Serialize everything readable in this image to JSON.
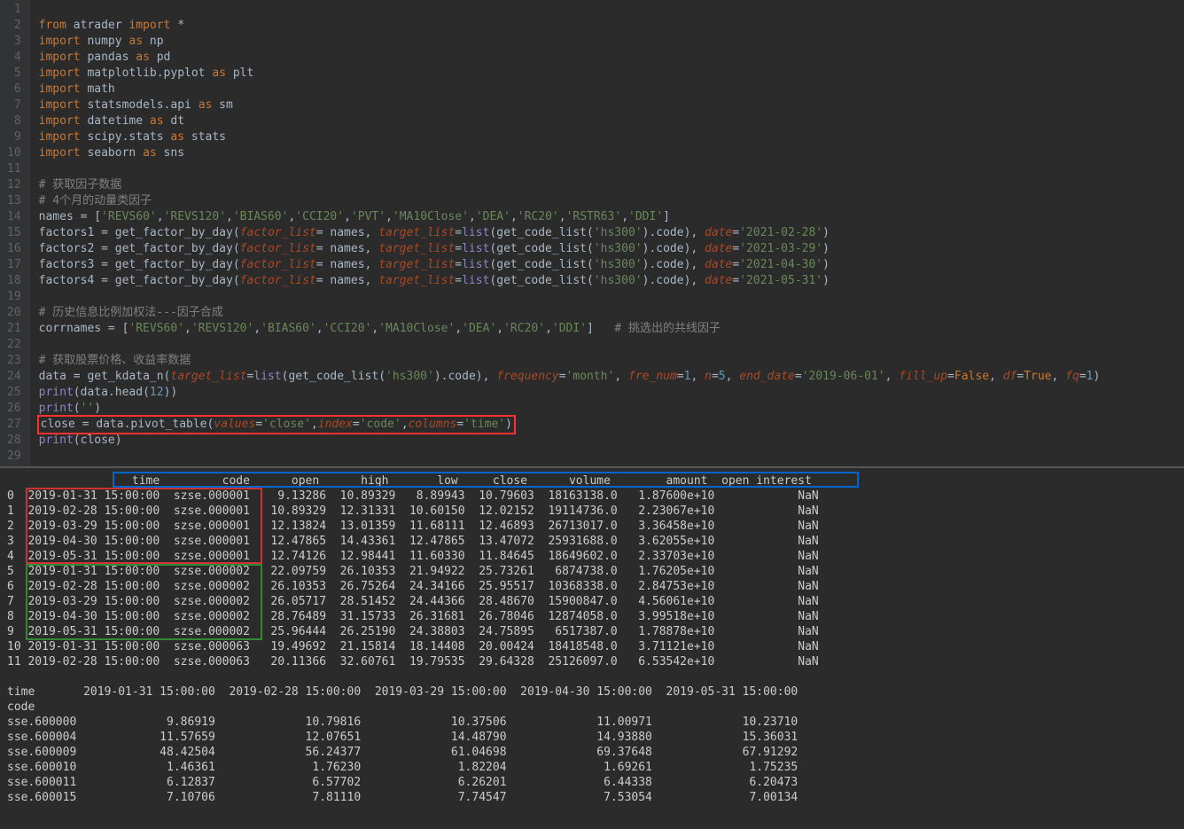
{
  "lineNumbers": [
    "1",
    "2",
    "3",
    "4",
    "5",
    "6",
    "7",
    "8",
    "9",
    "10",
    "11",
    "12",
    "13",
    "14",
    "15",
    "16",
    "17",
    "18",
    "19",
    "20",
    "21",
    "22",
    "23",
    "24",
    "25",
    "26",
    "27",
    "28",
    "29"
  ],
  "code": {
    "l2": {
      "kw1": "from",
      "mod": " atrader ",
      "kw2": "import",
      "rest": " *"
    },
    "l3": {
      "kw": "import",
      "mod": " numpy ",
      "kw2": "as",
      "alias": " np"
    },
    "l4": {
      "kw": "import",
      "mod": " pandas ",
      "kw2": "as",
      "alias": " pd"
    },
    "l5": {
      "kw": "import",
      "mod": " matplotlib.pyplot ",
      "kw2": "as",
      "alias": " plt"
    },
    "l6": {
      "kw": "import",
      "mod": " math"
    },
    "l7": {
      "kw": "import",
      "mod": " statsmodels.api ",
      "kw2": "as",
      "alias": " sm"
    },
    "l8": {
      "kw": "import",
      "mod": " datetime ",
      "kw2": "as",
      "alias": " dt"
    },
    "l9": {
      "kw": "import",
      "mod": " scipy.stats ",
      "kw2": "as",
      "alias": " stats"
    },
    "l10": {
      "kw": "import",
      "mod": " seaborn ",
      "kw2": "as",
      "alias": " sns"
    },
    "l12": {
      "com": "# 获取因子数据"
    },
    "l13": {
      "com": "# 4个月的动量类因子"
    },
    "l14": {
      "var": "names = [",
      "s1": "'REVS60'",
      "c1": ",",
      "s2": "'REVS120'",
      "c2": ",",
      "s3": "'BIAS60'",
      "c3": ",",
      "s4": "'CCI20'",
      "c4": ",",
      "s5": "'PVT'",
      "c5": ",",
      "s6": "'MA10Close'",
      "c6": ",",
      "s7": "'DEA'",
      "c7": ",",
      "s8": "'RC20'",
      "c8": ",",
      "s9": "'RSTR63'",
      "c9": ",",
      "s10": "'DDI'",
      "end": "]"
    },
    "l15": {
      "var": "factors1 = ",
      "fn": "get_factor_by_day",
      "p1": "(",
      "par1": "factor_list",
      "eq1": "= names, ",
      "par2": "target_list",
      "eq2": "=",
      "bi": "list",
      "p2": "(",
      "fn2": "get_code_list",
      "p3": "(",
      "s1": "'hs300'",
      "p4": ").code), ",
      "par3": "date",
      "eq3": "=",
      "s2": "'2021-02-28'",
      "end": ")"
    },
    "l16": {
      "var": "factors2 = ",
      "fn": "get_factor_by_day",
      "p1": "(",
      "par1": "factor_list",
      "eq1": "= names, ",
      "par2": "target_list",
      "eq2": "=",
      "bi": "list",
      "p2": "(",
      "fn2": "get_code_list",
      "p3": "(",
      "s1": "'hs300'",
      "p4": ").code), ",
      "par3": "date",
      "eq3": "=",
      "s2": "'2021-03-29'",
      "end": ")"
    },
    "l17": {
      "var": "factors3 = ",
      "fn": "get_factor_by_day",
      "p1": "(",
      "par1": "factor_list",
      "eq1": "= names, ",
      "par2": "target_list",
      "eq2": "=",
      "bi": "list",
      "p2": "(",
      "fn2": "get_code_list",
      "p3": "(",
      "s1": "'hs300'",
      "p4": ").code), ",
      "par3": "date",
      "eq3": "=",
      "s2": "'2021-04-30'",
      "end": ")"
    },
    "l18": {
      "var": "factors4 = ",
      "fn": "get_factor_by_day",
      "p1": "(",
      "par1": "factor_list",
      "eq1": "= names, ",
      "par2": "target_list",
      "eq2": "=",
      "bi": "list",
      "p2": "(",
      "fn2": "get_code_list",
      "p3": "(",
      "s1": "'hs300'",
      "p4": ").code), ",
      "par3": "date",
      "eq3": "=",
      "s2": "'2021-05-31'",
      "end": ")"
    },
    "l20": {
      "com": "# 历史信息比例加权法---因子合成"
    },
    "l21": {
      "var": "corrnames = [",
      "s1": "'REVS60'",
      "c1": ",",
      "s2": "'REVS120'",
      "c2": ",",
      "s3": "'BIAS60'",
      "c3": ",",
      "s4": "'CCI20'",
      "c4": ",",
      "s5": "'MA10Close'",
      "c5": ",",
      "s6": "'DEA'",
      "c6": ",",
      "s7": "'RC20'",
      "c7": ",",
      "s8": "'DDI'",
      "end": "]   ",
      "com": "# 挑选出的共线因子"
    },
    "l23": {
      "com": "# 获取股票价格、收益率数据"
    },
    "l24": {
      "var": "data = ",
      "fn": "get_kdata_n",
      "p1": "(",
      "par1": "target_list",
      "eq1": "=",
      "bi": "list",
      "p2": "(",
      "fn2": "get_code_list",
      "p3": "(",
      "s1": "'hs300'",
      "p4": ").code), ",
      "par2": "frequency",
      "eq2": "=",
      "s2": "'month'",
      "c1": ", ",
      "par3": "fre_num",
      "eq3": "=",
      "n1": "1",
      "c2": ", ",
      "par4": "n",
      "eq4": "=",
      "n2": "5",
      "c3": ", ",
      "par5": "end_date",
      "eq5": "=",
      "s3": "'2019-06-01'",
      "c4": ", ",
      "par6": "fill_up",
      "eq6": "=",
      "kw1": "False",
      "c5": ", ",
      "par7": "df",
      "eq7": "=",
      "kw2": "True",
      "c6": ", ",
      "par8": "fq",
      "eq8": "=",
      "n3": "1",
      "end": ")"
    },
    "l25": {
      "fn": "print",
      "p1": "(data.",
      "fn2": "head",
      "p2": "(",
      "n": "12",
      "end": "))"
    },
    "l26": {
      "fn": "print",
      "p1": "(",
      "s": "''",
      "end": ")"
    },
    "l27": {
      "var": "close = data.",
      "fn": "pivot_table",
      "p1": "(",
      "par1": "values",
      "eq1": "=",
      "s1": "'close'",
      "c1": ",",
      "par2": "index",
      "eq2": "=",
      "s2": "'code'",
      "c2": ",",
      "par3": "columns",
      "eq3": "=",
      "s3": "'time'",
      "end": ")"
    },
    "l28": {
      "fn": "print",
      "p1": "(close)"
    }
  },
  "output": {
    "header": {
      "idx": "  ",
      "time": "                time",
      "code": "         code",
      "open": "      open",
      "high": "      high",
      "low": "       low",
      "close": "     close",
      "volume": "      volume",
      "amount": "        amount",
      "open_interest": "  open_interest"
    },
    "rows": [
      {
        "idx": "0 ",
        "time": " 2019-01-31",
        "t2": " 15:00:00 ",
        "code": " szse.000001 ",
        "open": "   9.13286",
        "high": "  10.89329",
        "low": "   8.89943",
        "close": "  10.79603",
        "volume": "  18163138.0",
        "amount": "   1.87600e+10",
        "oi": "            NaN"
      },
      {
        "idx": "1 ",
        "time": " 2019-02-28",
        "t2": " 15:00:00 ",
        "code": " szse.000001 ",
        "open": "  10.89329",
        "high": "  12.31331",
        "low": "  10.60150",
        "close": "  12.02152",
        "volume": "  19114736.0",
        "amount": "   2.23067e+10",
        "oi": "            NaN"
      },
      {
        "idx": "2 ",
        "time": " 2019-03-29",
        "t2": " 15:00:00 ",
        "code": " szse.000001 ",
        "open": "  12.13824",
        "high": "  13.01359",
        "low": "  11.68111",
        "close": "  12.46893",
        "volume": "  26713017.0",
        "amount": "   3.36458e+10",
        "oi": "            NaN"
      },
      {
        "idx": "3 ",
        "time": " 2019-04-30",
        "t2": " 15:00:00 ",
        "code": " szse.000001 ",
        "open": "  12.47865",
        "high": "  14.43361",
        "low": "  12.47865",
        "close": "  13.47072",
        "volume": "  25931688.0",
        "amount": "   3.62055e+10",
        "oi": "            NaN"
      },
      {
        "idx": "4 ",
        "time": " 2019-05-31",
        "t2": " 15:00:00 ",
        "code": " szse.000001 ",
        "open": "  12.74126",
        "high": "  12.98441",
        "low": "  11.60330",
        "close": "  11.84645",
        "volume": "  18649602.0",
        "amount": "   2.33703e+10",
        "oi": "            NaN"
      },
      {
        "idx": "5 ",
        "time": " 2019-01-31",
        "t2": " 15:00:00 ",
        "code": " szse.000002 ",
        "open": "  22.09759",
        "high": "  26.10353",
        "low": "  21.94922",
        "close": "  25.73261",
        "volume": "   6874738.0",
        "amount": "   1.76205e+10",
        "oi": "            NaN"
      },
      {
        "idx": "6 ",
        "time": " 2019-02-28",
        "t2": " 15:00:00 ",
        "code": " szse.000002 ",
        "open": "  26.10353",
        "high": "  26.75264",
        "low": "  24.34166",
        "close": "  25.95517",
        "volume": "  10368338.0",
        "amount": "   2.84753e+10",
        "oi": "            NaN"
      },
      {
        "idx": "7 ",
        "time": " 2019-03-29",
        "t2": " 15:00:00 ",
        "code": " szse.000002 ",
        "open": "  26.05717",
        "high": "  28.51452",
        "low": "  24.44366",
        "close": "  28.48670",
        "volume": "  15900847.0",
        "amount": "   4.56061e+10",
        "oi": "            NaN"
      },
      {
        "idx": "8 ",
        "time": " 2019-04-30",
        "t2": " 15:00:00 ",
        "code": " szse.000002 ",
        "open": "  28.76489",
        "high": "  31.15733",
        "low": "  26.31681",
        "close": "  26.78046",
        "volume": "  12874058.0",
        "amount": "   3.99518e+10",
        "oi": "            NaN"
      },
      {
        "idx": "9 ",
        "time": " 2019-05-31",
        "t2": " 15:00:00 ",
        "code": " szse.000002 ",
        "open": "  25.96444",
        "high": "  26.25190",
        "low": "  24.38803",
        "close": "  24.75895",
        "volume": "   6517387.0",
        "amount": "   1.78878e+10",
        "oi": "            NaN"
      },
      {
        "idx": "10",
        "time": " 2019-01-31",
        "t2": " 15:00:00 ",
        "code": " szse.000063 ",
        "open": "  19.49692",
        "high": "  21.15814",
        "low": "  18.14408",
        "close": "  20.00424",
        "volume": "  18418548.0",
        "amount": "   3.71121e+10",
        "oi": "            NaN"
      },
      {
        "idx": "11",
        "time": " 2019-02-28",
        "t2": " 15:00:00 ",
        "code": " szse.000063 ",
        "open": "  20.11366",
        "high": "  32.60761",
        "low": "  19.79535",
        "close": "  29.64328",
        "volume": "  25126097.0",
        "amount": "   6.53542e+10",
        "oi": "            NaN"
      }
    ],
    "pivot_header": {
      "label": "time",
      "c1": "       2019-01-31 15:00:00",
      "c2": "  2019-02-28 15:00:00",
      "c3": "  2019-03-29 15:00:00",
      "c4": "  2019-04-30 15:00:00",
      "c5": "  2019-05-31 15:00:00"
    },
    "pivot_index": "code",
    "pivot_rows": [
      {
        "code": "sse.600000",
        "v1": "             9.86919",
        "v2": "             10.79816",
        "v3": "             10.37506",
        "v4": "             11.00971",
        "v5": "             10.23710"
      },
      {
        "code": "sse.600004",
        "v1": "            11.57659",
        "v2": "             12.07651",
        "v3": "             14.48790",
        "v4": "             14.93880",
        "v5": "             15.36031"
      },
      {
        "code": "sse.600009",
        "v1": "            48.42504",
        "v2": "             56.24377",
        "v3": "             61.04698",
        "v4": "             69.37648",
        "v5": "             67.91292"
      },
      {
        "code": "sse.600010",
        "v1": "             1.46361",
        "v2": "              1.76230",
        "v3": "              1.82204",
        "v4": "              1.69261",
        "v5": "              1.75235"
      },
      {
        "code": "sse.600011",
        "v1": "             6.12837",
        "v2": "              6.57702",
        "v3": "              6.26201",
        "v4": "              6.44338",
        "v5": "              6.20473"
      },
      {
        "code": "sse.600015",
        "v1": "             7.10706",
        "v2": "              7.81110",
        "v3": "              7.74547",
        "v4": "              7.53054",
        "v5": "              7.00134"
      }
    ]
  }
}
